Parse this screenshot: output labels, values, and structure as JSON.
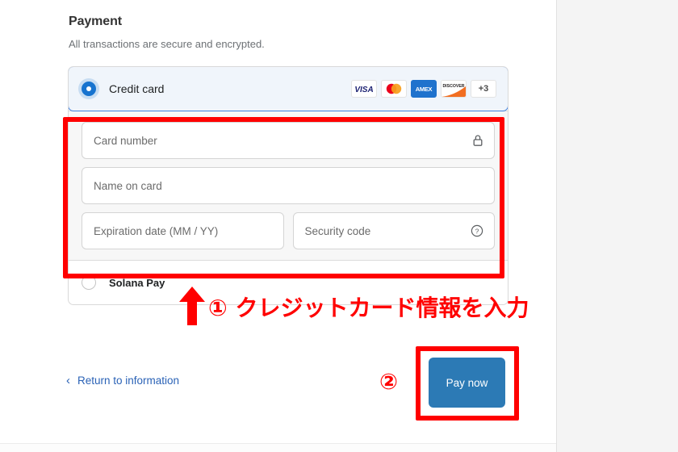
{
  "page": {
    "section_title": "Payment",
    "section_subtitle": "All transactions are secure and encrypted."
  },
  "payment_methods": [
    {
      "id": "credit-card",
      "label": "Credit card",
      "selected": true,
      "brands": [
        "VISA",
        "Mastercard",
        "AMEX",
        "DISCOVER"
      ],
      "brands_more_label": "+3"
    },
    {
      "id": "solana-pay",
      "label": "Solana Pay",
      "selected": false
    }
  ],
  "card_form": {
    "card_number": {
      "placeholder": "Card number",
      "value": "",
      "icon": "lock-icon"
    },
    "name_on_card": {
      "placeholder": "Name on card",
      "value": ""
    },
    "expiration": {
      "placeholder": "Expiration date (MM / YY)",
      "value": ""
    },
    "security_code": {
      "placeholder": "Security code",
      "value": "",
      "icon": "question-circle-icon"
    }
  },
  "footer": {
    "return_link": "Return to information",
    "return_chevron": "‹",
    "pay_button": "Pay now"
  },
  "annotations": {
    "step1_text": "① クレジットカード情報を入力",
    "step2_marker": "②",
    "color": "#ff0000"
  },
  "colors": {
    "accent_blue": "#1773cf",
    "pay_button_blue": "#2c7ab5",
    "link_blue": "#2a62b6",
    "selected_row_bg": "#f0f5fb",
    "form_bg": "#f7f7f7",
    "right_panel_bg": "#f4f4f4"
  }
}
